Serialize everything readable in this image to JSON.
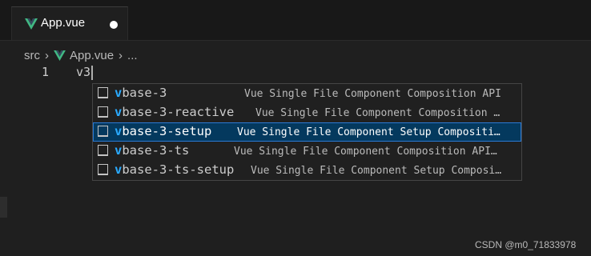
{
  "tab": {
    "label": "App.vue",
    "modified": true
  },
  "breadcrumb": {
    "items": [
      "src",
      "App.vue",
      "..."
    ]
  },
  "editor": {
    "line_number": "1",
    "text": "v3"
  },
  "suggest": {
    "items": [
      {
        "prefix": "v",
        "match": "base-3",
        "suffix": "",
        "detail": "Vue Single File Component Composition API",
        "selected": false
      },
      {
        "prefix": "v",
        "match": "base-3",
        "suffix": "-reactive",
        "detail": "Vue Single File Component Composition …",
        "selected": false
      },
      {
        "prefix": "v",
        "match": "base-3",
        "suffix": "-setup",
        "detail": "Vue Single File Component Setup Compositi…",
        "selected": true
      },
      {
        "prefix": "v",
        "match": "base-3",
        "suffix": "-ts",
        "detail": "Vue Single File Component Composition API…",
        "selected": false
      },
      {
        "prefix": "v",
        "match": "base-3",
        "suffix": "-ts-setup",
        "detail": "Vue Single File Component Setup Composi…",
        "selected": false
      }
    ],
    "icon": "snippet-icon"
  },
  "watermark": "CSDN @m0_71833978",
  "colors": {
    "accent": "#2aaaff",
    "vue_green": "#41b883",
    "selection": "#04395e"
  }
}
